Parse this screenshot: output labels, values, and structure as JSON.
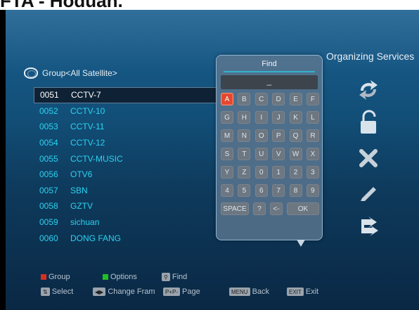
{
  "page_heading": "FTA - Hoduan.",
  "header": {
    "title": "Organizing Services"
  },
  "group": {
    "label": "Group<All Satellite>"
  },
  "channels": [
    {
      "num": "0051",
      "name": "CCTV-7",
      "selected": true
    },
    {
      "num": "0052",
      "name": "CCTV-10"
    },
    {
      "num": "0053",
      "name": "CCTV-11"
    },
    {
      "num": "0054",
      "name": "CCTV-12"
    },
    {
      "num": "0055",
      "name": "CCTV-MUSIC"
    },
    {
      "num": "0056",
      "name": "OTV6"
    },
    {
      "num": "0057",
      "name": "SBN"
    },
    {
      "num": "0058",
      "name": "GZTV"
    },
    {
      "num": "0059",
      "name": "sichuan"
    },
    {
      "num": "0060",
      "name": "DONG FANG"
    }
  ],
  "find": {
    "title": "Find",
    "input_value": "_",
    "keys": [
      [
        "A",
        "B",
        "C",
        "D",
        "E",
        "F"
      ],
      [
        "G",
        "H",
        "I",
        "J",
        "K",
        "L"
      ],
      [
        "M",
        "N",
        "O",
        "P",
        "Q",
        "R"
      ],
      [
        "S",
        "T",
        "U",
        "V",
        "W",
        "X"
      ],
      [
        "Y",
        "Z",
        "0",
        "1",
        "2",
        "3"
      ],
      [
        "4",
        "5",
        "6",
        "7",
        "8",
        "9"
      ],
      [
        "SPACE",
        "?",
        "<-",
        "OK"
      ]
    ],
    "active_key": "A"
  },
  "legend": {
    "group": "Group",
    "options": "Options",
    "find": "Find",
    "select": "Select",
    "change_fram": "Change Fram",
    "pip_key": "P+P-",
    "page": "Page",
    "menu_key": "MENU",
    "back": "Back",
    "exit_key": "EXIT",
    "exit": "Exit"
  },
  "icons": {
    "move": "move-icon",
    "lock": "lock-icon",
    "delete": "delete-icon",
    "rename": "rename-icon",
    "skip": "skip-icon"
  },
  "colors": {
    "background": "#124f78",
    "accent": "#2ad3f0",
    "red": "#d92d22",
    "green": "#20c020"
  }
}
